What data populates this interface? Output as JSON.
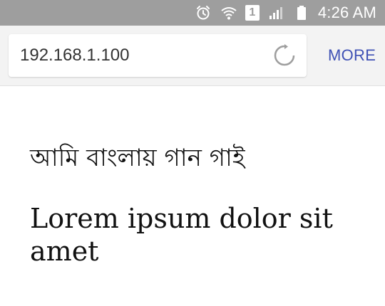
{
  "status_bar": {
    "time": "4:26 AM",
    "sim_number": "1",
    "icons": [
      "alarm-icon",
      "wifi-icon",
      "sim-icon",
      "signal-icon",
      "battery-icon"
    ]
  },
  "browser": {
    "url": "192.168.1.100",
    "more_label": "MORE",
    "icons": [
      "reload-icon"
    ]
  },
  "page": {
    "bengali_text": "আমি বাংলায় গান গাই",
    "lorem_text": "Lorem ipsum dolor sit amet"
  },
  "colors": {
    "status_bar_bg": "#9e9e9e",
    "toolbar_bg": "#f3f3f3",
    "accent": "#3f51b5"
  }
}
